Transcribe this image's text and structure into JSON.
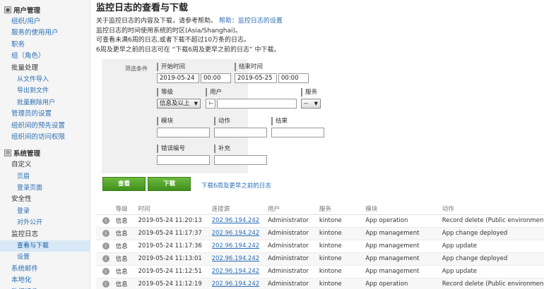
{
  "sidebar": {
    "user_mgmt": {
      "title": "用户管理",
      "items": [
        {
          "label": "组织/用户",
          "level": 1,
          "link": true
        },
        {
          "label": "服务的使用用户",
          "level": 1,
          "link": true
        },
        {
          "label": "职务",
          "level": 1,
          "link": true
        },
        {
          "label": "组（角色）",
          "level": 1,
          "link": true
        },
        {
          "label": "批量处理",
          "level": 1,
          "link": false
        },
        {
          "label": "从文件导入",
          "level": 2,
          "link": true
        },
        {
          "label": "导出到文件",
          "level": 2,
          "link": true
        },
        {
          "label": "批量删除用户",
          "level": 2,
          "link": true
        },
        {
          "label": "管理员的设置",
          "level": 1,
          "link": true
        },
        {
          "label": "组织间的预先设置",
          "level": 1,
          "link": true
        },
        {
          "label": "组织间的访问权限",
          "level": 1,
          "link": true
        }
      ]
    },
    "sys_mgmt": {
      "title": "系统管理",
      "items": [
        {
          "label": "自定义",
          "level": 1,
          "link": false
        },
        {
          "label": "页眉",
          "level": 2,
          "link": true
        },
        {
          "label": "登录页面",
          "level": 2,
          "link": true
        },
        {
          "label": "安全性",
          "level": 1,
          "link": false
        },
        {
          "label": "登录",
          "level": 2,
          "link": true
        },
        {
          "label": "对外公开",
          "level": 2,
          "link": true
        },
        {
          "label": "监控日志",
          "level": 1,
          "link": false
        },
        {
          "label": "查看与下载",
          "level": 2,
          "link": true,
          "active": true
        },
        {
          "label": "设置",
          "level": 2,
          "link": true
        },
        {
          "label": "系统邮件",
          "level": 1,
          "link": true
        },
        {
          "label": "本地化",
          "level": 1,
          "link": true
        },
        {
          "label": "数据镜像",
          "level": 1,
          "link": true
        }
      ]
    }
  },
  "main": {
    "title": "监控日志的查看与下载",
    "desc_line1": "关于监控日志的内容及下载，请参考帮助。",
    "help_link": "帮助：监控日志的设置",
    "desc_line2": "监控日志的时间使用系统的时区(Asia/Shanghai)。",
    "desc_line3": "可查看未满6周的日志,或者下载不超过10万条的日志。",
    "desc_line4": "6周及更早之前的日志可在 “下载6周及更早之前的日志” 中下载。"
  },
  "filter": {
    "label": "筛选条件",
    "start_label": "开始时间",
    "start_date": "2019-05-24",
    "start_time": "00:00",
    "end_label": "结束时间",
    "end_date": "2019-05-25",
    "end_time": "00:00",
    "level_label": "等级",
    "level_value": "信息及以上",
    "user_label": "用户",
    "user_value": "",
    "service_label": "服务",
    "service_value": "--",
    "module_label": "模块",
    "action_label": "动作",
    "result_label": "结果",
    "error_label": "错误编号",
    "extra_label": "补充"
  },
  "buttons": {
    "view": "查看",
    "download": "下载",
    "old_link": "下载6周及更早之前的日志"
  },
  "table": {
    "headers": [
      "",
      "等级",
      "时间",
      "连接源",
      "用户",
      "服务",
      "模块",
      "动作"
    ],
    "rows": [
      {
        "level": "信息",
        "time": "2019-05-24 11:20:13",
        "source": "202.96.194.242",
        "user": "Administrator",
        "service": "kintone",
        "module": "App operation",
        "action": "Record delete (Public environment)"
      },
      {
        "level": "信息",
        "time": "2019-05-24 11:17:37",
        "source": "202.96.194.242",
        "user": "Administrator",
        "service": "kintone",
        "module": "App management",
        "action": "App change deployed"
      },
      {
        "level": "信息",
        "time": "2019-05-24 11:17:36",
        "source": "202.96.194.242",
        "user": "Administrator",
        "service": "kintone",
        "module": "App management",
        "action": "App update"
      },
      {
        "level": "信息",
        "time": "2019-05-24 11:13:01",
        "source": "202.96.194.242",
        "user": "Administrator",
        "service": "kintone",
        "module": "App management",
        "action": "App change deployed"
      },
      {
        "level": "信息",
        "time": "2019-05-24 11:12:51",
        "source": "202.96.194.242",
        "user": "Administrator",
        "service": "kintone",
        "module": "App management",
        "action": "App update"
      },
      {
        "level": "信息",
        "time": "2019-05-24 11:12:19",
        "source": "202.96.194.242",
        "user": "Administrator",
        "service": "kintone",
        "module": "App operation",
        "action": "Record delete (Public environment)"
      }
    ]
  }
}
